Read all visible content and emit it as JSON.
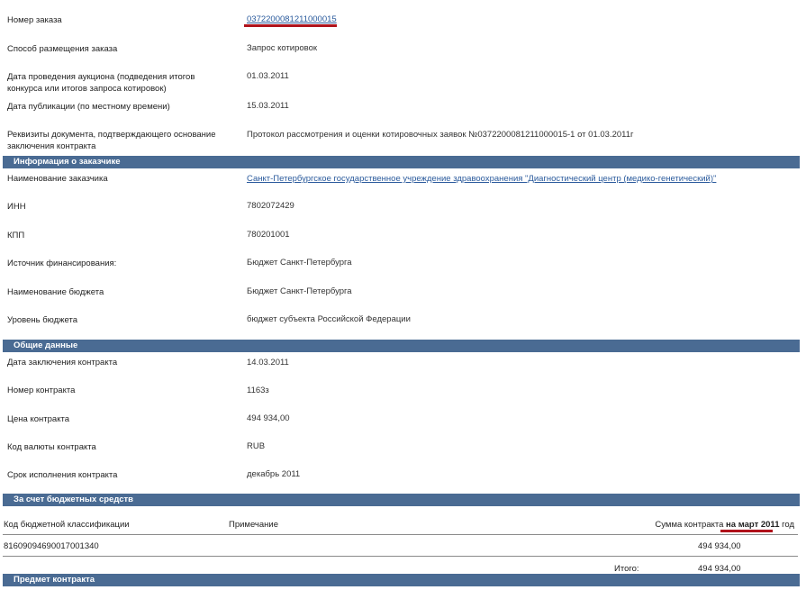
{
  "order": {
    "number_label": "Номер заказа",
    "number_value": "0372200081211000015",
    "method_label": "Способ размещения заказа",
    "method_value": "Запрос котировок",
    "auction_date_label": "Дата проведения аукциона (подведения итогов конкурса или итогов запроса котировок)",
    "auction_date_value": "01.03.2011",
    "publish_date_label": "Дата публикации (по местному времени)",
    "publish_date_value": "15.03.2011",
    "requisites_label": "Реквизиты документа, подтверждающего основание заключения контракта",
    "requisites_value": "Протокол рассмотрения и оценки котировочных заявок №0372200081211000015-1 от 01.03.2011г"
  },
  "customer": {
    "section_title": "Информация о заказчике",
    "name_label": "Наименование заказчика",
    "name_value": "Санкт-Петербургское государственное учреждение здравоохранения \"Диагностический центр (медико-генетический)\"",
    "inn_label": "ИНН",
    "inn_value": "7802072429",
    "kpp_label": "КПП",
    "kpp_value": "780201001",
    "source_label": "Источник финансирования:",
    "source_value": "Бюджет Санкт-Петербурга",
    "budget_name_label": "Наименование бюджета",
    "budget_name_value": "Бюджет Санкт-Петербурга",
    "budget_level_label": "Уровень бюджета",
    "budget_level_value": "бюджет субъекта Российской Федерации"
  },
  "general": {
    "section_title": "Общие данные",
    "contract_date_label": "Дата заключения контракта",
    "contract_date_value": "14.03.2011",
    "contract_number_label": "Номер контракта",
    "contract_number_value": "1163з",
    "price_label": "Цена контракта",
    "price_value": "494 934,00",
    "currency_label": "Код валюты контракта",
    "currency_value": "RUB",
    "term_label": "Срок исполнения контракта",
    "term_value": "декабрь 2011"
  },
  "budget_funds": {
    "section_title": "За счет бюджетных средств",
    "col_code": "Код бюджетной классификации",
    "col_note": "Примечание",
    "col_sum_prefix": "Сумма контракта ",
    "col_sum_highlight": "на март 2011",
    "col_sum_suffix": " год",
    "rows": [
      {
        "code": "81609094690017001340",
        "note": "",
        "sum": "494 934,00"
      }
    ],
    "total_label": "Итого:",
    "total_value": "494 934,00"
  },
  "subject": {
    "section_title": "Предмет контракта"
  },
  "colors": {
    "section_bg": "#4a6b93",
    "link": "#2a5a9c",
    "highlight_underline": "#b0121b"
  }
}
